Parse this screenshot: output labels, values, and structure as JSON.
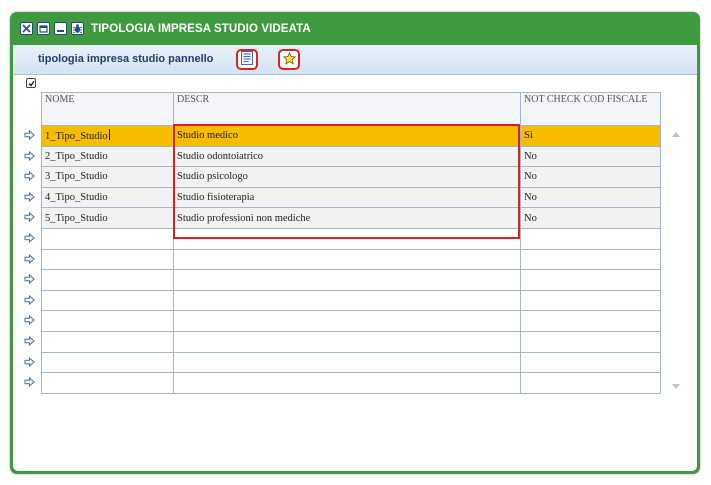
{
  "window": {
    "title": "TIPOLOGIA IMPRESA STUDIO VIDEATA"
  },
  "panel": {
    "title": "tipologia impresa studio pannello"
  },
  "grid": {
    "columns": [
      "NOME",
      "DESCR",
      "NOT CHECK COD FISCALE"
    ],
    "rows": [
      {
        "nome": "1_Tipo_Studio",
        "descr": "Studio medico",
        "check": "Si"
      },
      {
        "nome": "2_Tipo_Studio",
        "descr": "Studio odontoiatrico",
        "check": "No"
      },
      {
        "nome": "3_Tipo_Studio",
        "descr": "Studio psicologo",
        "check": "No"
      },
      {
        "nome": "4_Tipo_Studio",
        "descr": "Studio fisioterapia",
        "check": "No"
      },
      {
        "nome": "5_Tipo_Studio",
        "descr": "Studio professioni non mediche",
        "check": "No"
      },
      {
        "nome": "",
        "descr": "",
        "check": ""
      },
      {
        "nome": "",
        "descr": "",
        "check": ""
      },
      {
        "nome": "",
        "descr": "",
        "check": ""
      },
      {
        "nome": "",
        "descr": "",
        "check": ""
      },
      {
        "nome": "",
        "descr": "",
        "check": ""
      },
      {
        "nome": "",
        "descr": "",
        "check": ""
      },
      {
        "nome": "",
        "descr": "",
        "check": ""
      },
      {
        "nome": "",
        "descr": "",
        "check": ""
      }
    ],
    "selected_row": 0
  },
  "colors": {
    "titlebar": "#3f9a3f",
    "selected_row": "#f7bc00",
    "highlight": "#e02020"
  },
  "icons": {
    "titlebar": [
      "close-icon",
      "restore-icon",
      "minimize-icon",
      "bug-icon"
    ],
    "toolbar": [
      "list-view-icon",
      "star-icon"
    ],
    "row": "arrow-right-icon"
  }
}
